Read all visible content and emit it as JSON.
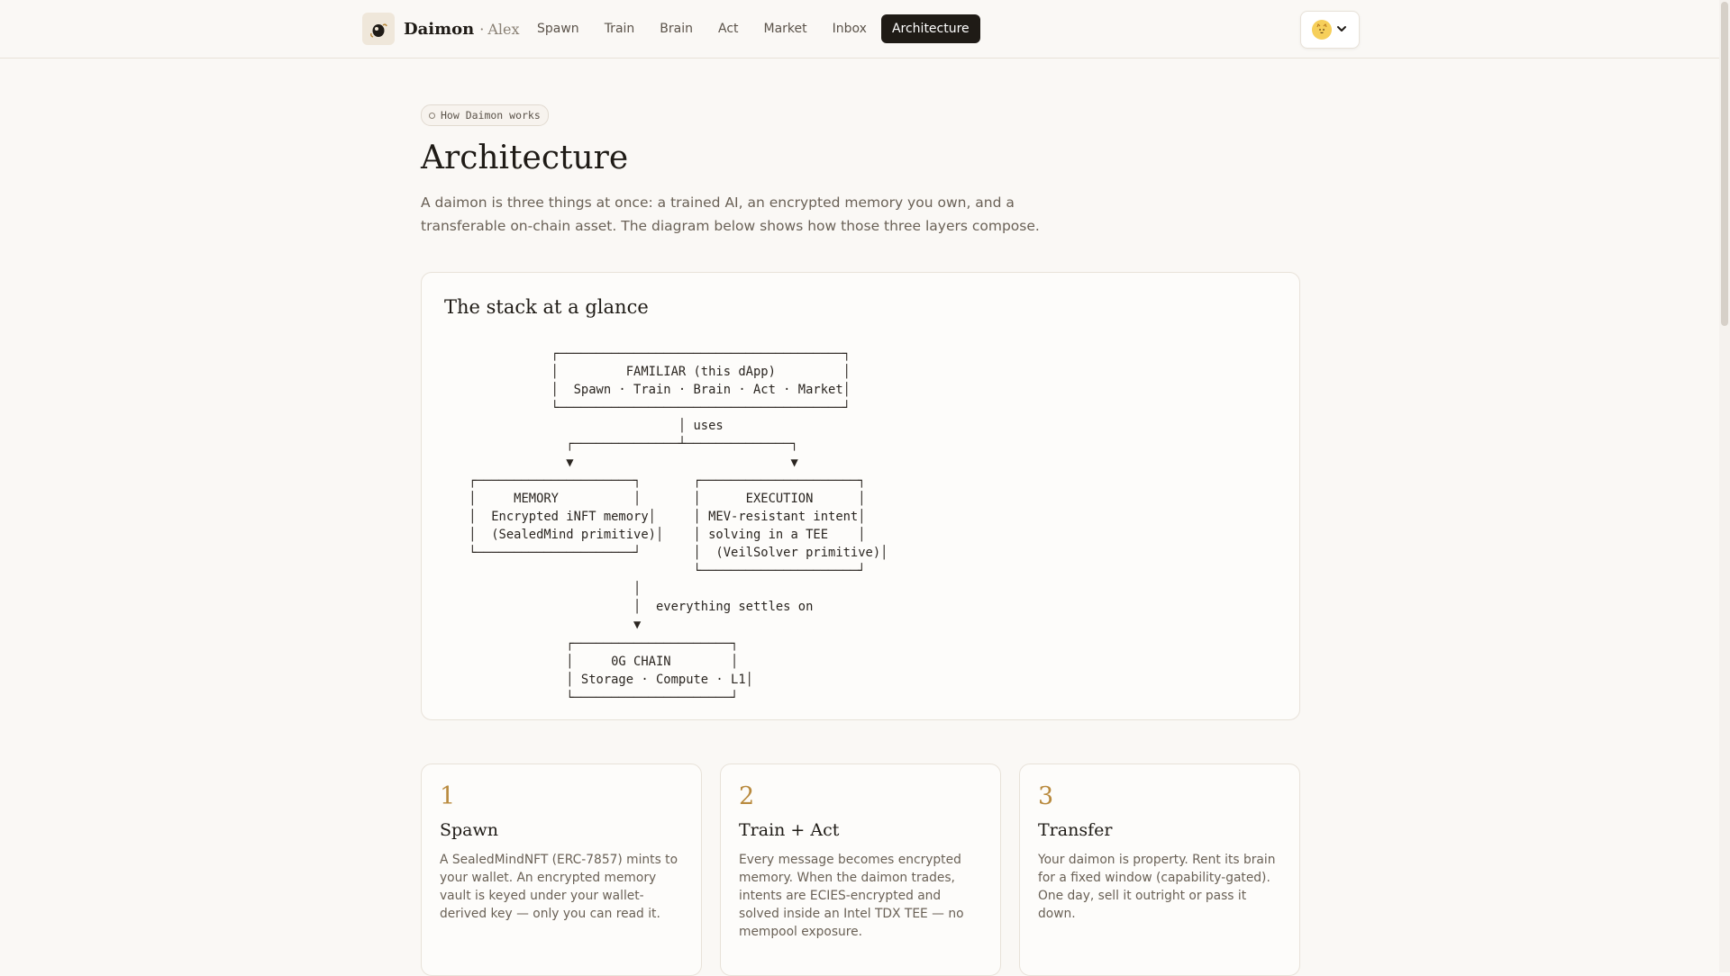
{
  "brand": {
    "name": "Daimon",
    "separator": "·",
    "user": "Alex"
  },
  "nav": {
    "items": [
      {
        "label": "Spawn"
      },
      {
        "label": "Train"
      },
      {
        "label": "Brain"
      },
      {
        "label": "Act"
      },
      {
        "label": "Market"
      },
      {
        "label": "Inbox"
      },
      {
        "label": "Architecture",
        "active": true
      }
    ]
  },
  "page": {
    "eyebrow": "How Daimon works",
    "title": "Architecture",
    "lede": "A daimon is three things at once: a trained AI, an encrypted memory you own, and a transferable on-chain asset. The diagram below shows how those three layers compose."
  },
  "stack": {
    "title": "The stack at a glance",
    "diagram": "            ┌──────────────────────────────────────┐\n            │         FAMILIAR (this dApp)         │\n            │  Spawn · Train · Brain · Act · Market│\n            └──────────────────────────────────────┘\n                             │ uses\n              ┌──────────────┴──────────────┐\n              ▼                             ▼\n ┌─────────────────────┐       ┌─────────────────────┐\n │     MEMORY          │       │      EXECUTION      │\n │  Encrypted iNFT memory│     │ MEV-resistant intent│\n │  (SealedMind primitive)│    │ solving in a TEE    │\n └─────────────────────┘       │  (VeilSolver primitive)│\n                               └─────────────────────┘\n                       │\n                       │  everything settles on\n                       ▼\n              ┌─────────────────────┐\n              │     0G CHAIN        │\n              │ Storage · Compute · L1│\n              └─────────────────────┘"
  },
  "steps": [
    {
      "num": "1",
      "title": "Spawn",
      "body": "A SealedMindNFT (ERC-7857) mints to your wallet. An encrypted memory vault is keyed under your wallet-derived key — only you can read it."
    },
    {
      "num": "2",
      "title": "Train + Act",
      "body": "Every message becomes encrypted memory. When the daimon trades, intents are ECIES-encrypted and solved inside an Intel TDX TEE — no mempool exposure."
    },
    {
      "num": "3",
      "title": "Transfer",
      "body": "Your daimon is property. Rent its brain for a fixed window (capability-gated). One day, sell it outright or pass it down."
    }
  ],
  "icons": {
    "logo": "daimon-eye-icon",
    "avatar": "cat-face-icon",
    "dropdown": "chevron-down-icon",
    "eyebrow": "circle-icon"
  },
  "colors": {
    "accent": "#b98a3e",
    "active_nav": "#1f1b16",
    "background": "#faf8f5"
  }
}
